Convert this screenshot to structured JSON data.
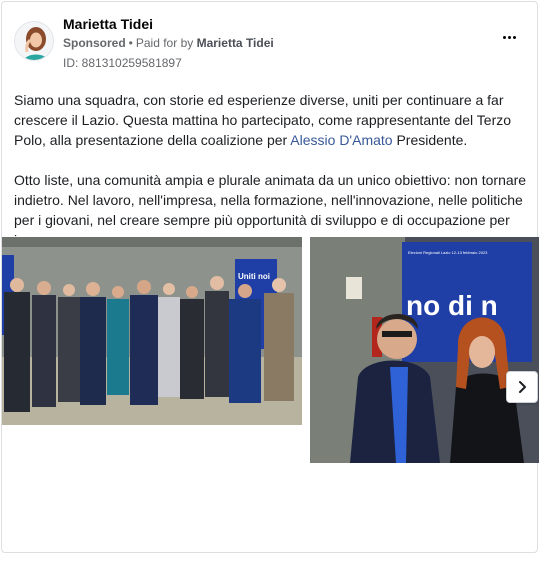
{
  "post": {
    "author": "Marietta Tidei",
    "sponsored_label": "Sponsored",
    "separator": "•",
    "paid_for_prefix": "Paid for by",
    "payer": "Marietta Tidei",
    "ad_id": "ID: 881310259581897",
    "paragraph1_before_link": "Siamo una squadra, con storie ed esperienze diverse, uniti per continuare a far crescere il Lazio. Questa mattina ho partecipato, come rappresentante del Terzo Polo, alla presentazione della coalizione per ",
    "paragraph1_link": "Alessio D'Amato",
    "paragraph1_after_link": " Presidente.",
    "paragraph2": "Otto liste, una comunità ampia e plurale animata da un unico obiettivo: non tornare indietro. Nel lavoro, nell'impresa, nella formazione, nell'innovazione, nelle politiche per i giovani, nel creare sempre più opportunità di sviluppo e di occupazione per i…"
  },
  "photos": {
    "photo1_banner_text": "Uniti noi",
    "photo2_banner_text": "no di n",
    "photo2_banner_small": "Elezioni Regionali Lazio 12-13 febbraio 2023"
  },
  "colors": {
    "link": "#385898",
    "banner_blue": "#1f3fa6",
    "meta_gray": "#65676b"
  },
  "icons": {
    "more": "more-options-icon",
    "next": "chevron-right-icon"
  }
}
